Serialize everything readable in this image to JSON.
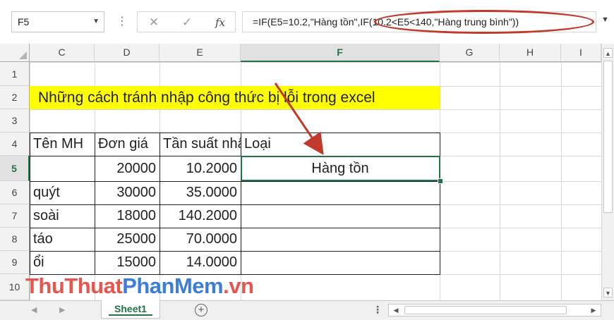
{
  "formula_bar": {
    "name_box": "F5",
    "fx_label": "fx",
    "formula": "=IF(E5=10.2,\"Hàng tồn\",IF(10.2<E5<140,\"Hàng trung bình\"))"
  },
  "columns": [
    "C",
    "D",
    "E",
    "F",
    "G",
    "H",
    "I"
  ],
  "active_column": "F",
  "rows": [
    "1",
    "2",
    "3",
    "4",
    "5",
    "6",
    "7",
    "8",
    "9",
    "10"
  ],
  "active_row": "5",
  "title": "Những cách tránh nhập công thức bị lỗi trong excel",
  "table": {
    "headers": [
      "Tên MH",
      "Đơn giá",
      "Tần suất nhậ",
      "Loại"
    ],
    "rows": [
      {
        "name": "",
        "price": "20000",
        "freq": "10.2000",
        "type": "Hàng tồn"
      },
      {
        "name": "quýt",
        "price": "30000",
        "freq": "35.0000",
        "type": ""
      },
      {
        "name": "soài",
        "price": "18000",
        "freq": "140.2000",
        "type": ""
      },
      {
        "name": "táo",
        "price": "25000",
        "freq": "70.0000",
        "type": ""
      },
      {
        "name": "ổi",
        "price": "15000",
        "freq": "14.0000",
        "type": ""
      }
    ]
  },
  "sheet_tabs": [
    {
      "label": "Sheet1",
      "active": true
    }
  ],
  "watermark": {
    "part1": "ThuThuat",
    "part2": "PhanMem",
    "part3": ".vn"
  },
  "colors": {
    "accent": "#217346",
    "highlight_fill": "#ffff00",
    "annotation": "#c0392b"
  }
}
